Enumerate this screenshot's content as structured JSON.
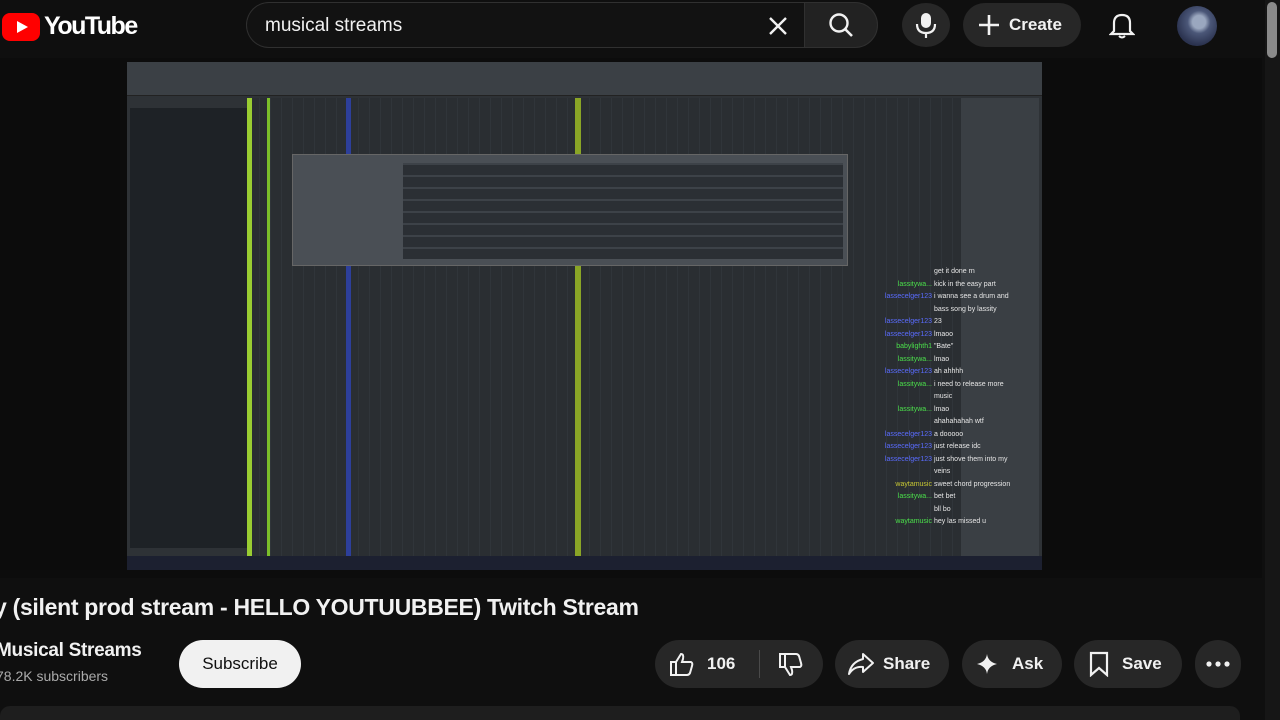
{
  "header": {
    "logo_text": "YouTube",
    "search_value": "musical streams",
    "create_label": "Create"
  },
  "video": {
    "title": "y (silent prod stream - HELLO YOUTUUBBEE) Twitch Stream",
    "chat_lines": [
      {
        "user": "",
        "text": "get it done rn",
        "color": "u1"
      },
      {
        "user": "lassitywa...",
        "text": "kick in the easy part",
        "color": "u1"
      },
      {
        "user": "lassecelger123",
        "text": "i wanna see a drum and",
        "color": "u2"
      },
      {
        "user": "",
        "text": "bass song by lassity",
        "color": "u2"
      },
      {
        "user": "lassecelger123",
        "text": "23",
        "color": "u2"
      },
      {
        "user": "lassecelger123",
        "text": "lmaoo",
        "color": "u2"
      },
      {
        "user": "babylighth1",
        "text": "\"Bate\"",
        "color": "u1"
      },
      {
        "user": "lassitywa...",
        "text": "lmao",
        "color": "u1"
      },
      {
        "user": "lassecelger123",
        "text": "ah ahhhh",
        "color": "u2"
      },
      {
        "user": "lassitywa...",
        "text": "i need to release more",
        "color": "u1"
      },
      {
        "user": "",
        "text": "music",
        "color": "u1"
      },
      {
        "user": "lassitywa...",
        "text": "lmao",
        "color": "u1"
      },
      {
        "user": "",
        "text": "ahahahahah wtf",
        "color": "u2"
      },
      {
        "user": "lassecelger123",
        "text": "a dooooo",
        "color": "u2"
      },
      {
        "user": "lassecelger123",
        "text": "just release idc",
        "color": "u2"
      },
      {
        "user": "lassecelger123",
        "text": "just shove them into my",
        "color": "u2"
      },
      {
        "user": "",
        "text": "veins",
        "color": "u2"
      },
      {
        "user": "waytamusic",
        "text": "sweet chord progression",
        "color": "u3"
      },
      {
        "user": "lassitywa...",
        "text": "bet bet",
        "color": "u1"
      },
      {
        "user": "",
        "text": "bll bo",
        "color": "u4"
      },
      {
        "user": "waytamusic",
        "text": "hey las missed u",
        "color": "u1"
      }
    ]
  },
  "channel": {
    "name": "Musical Streams",
    "subscribers": "78.2K subscribers",
    "subscribe_label": "Subscribe"
  },
  "actions": {
    "like_count": "106",
    "share_label": "Share",
    "ask_label": "Ask",
    "save_label": "Save"
  }
}
